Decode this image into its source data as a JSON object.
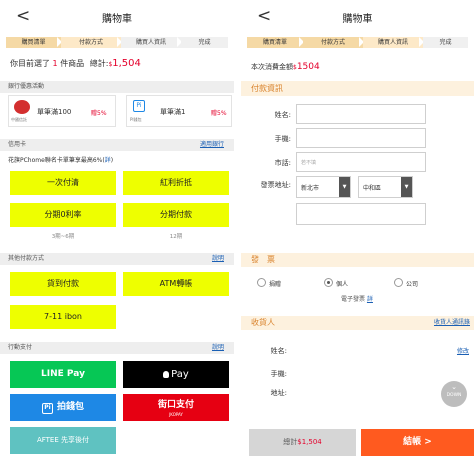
{
  "left": {
    "title": "購物車",
    "back_glyph": "<",
    "steps": [
      "購買清單",
      "付款方式",
      "購買人資訊",
      "完成"
    ],
    "summary_prefix": "你目前選了",
    "summary_count": "1",
    "summary_mid": "件商品",
    "summary_total_label": "總計:",
    "summary_currency": "$",
    "summary_total": "1,504",
    "bank_section": "銀行優惠活動",
    "bank_cards": [
      {
        "bank": "中國信託",
        "title": "單筆滿100",
        "badge": "贈5%"
      },
      {
        "bank": "PI錢包",
        "title": "單筆滿1",
        "badge": "贈5%"
      }
    ],
    "credit_section": "信用卡",
    "credit_link": "適用銀行",
    "credit_promo": "花旗PChome聯名卡單筆享最高6%",
    "credit_promo_link": "詳",
    "credit_buttons": [
      {
        "label": "一次付清",
        "sub": ""
      },
      {
        "label": "紅利折抵",
        "sub": ""
      },
      {
        "label": "分期0利率",
        "sub": "3期~6期"
      },
      {
        "label": "分期付款",
        "sub": "12期"
      }
    ],
    "other_section": "其他付款方式",
    "other_link": "說明",
    "other_buttons": [
      "貨到付款",
      "ATM轉帳",
      "7-11 ibon"
    ],
    "mobile_section": "行動支付",
    "mobile_link": "說明",
    "mobile_buttons": [
      "LINE Pay",
      "Pay",
      "拍錢包",
      "街口支付",
      "AFTEE 先享後付"
    ],
    "jko_sub": "JKOPAY",
    "colors": {
      "line": "#06c755",
      "apple": "#000000",
      "pi": "#1e88e5",
      "jko": "#e60012",
      "aftee": "#5fc2c1",
      "yellow": "#eeff00",
      "price": "#e4002b"
    }
  },
  "right": {
    "title": "購物車",
    "back_glyph": "<",
    "steps": [
      "購買清單",
      "付款方式",
      "購買人資訊",
      "完成"
    ],
    "amount_label": "本次消費金額",
    "amount_currency": "$",
    "amount": "1504",
    "payinfo_section": "付款資訊",
    "fields": {
      "name": "姓名:",
      "phone": "手機:",
      "district": "市話:",
      "district_placeholder": "若不填",
      "address": "發票地址:"
    },
    "city_value": "新北市",
    "district_value": "中和區",
    "invoice_section": "發　票",
    "invoice_options": [
      "捐贈",
      "個人",
      "公司"
    ],
    "invoice_selected": 1,
    "einvoice_label": "電子發票",
    "einvoice_link": "詳",
    "receiver_section": "收貨人",
    "receiver_link": "收貨人通訊錄",
    "receiver_fields": {
      "name": "姓名:",
      "phone": "手機:",
      "address": "地址:"
    },
    "receiver_edit_link": "修改",
    "down_label": "DOWN",
    "bottom_total_label": "總計",
    "bottom_total": "$1,504",
    "checkout_label": "結帳 >"
  }
}
